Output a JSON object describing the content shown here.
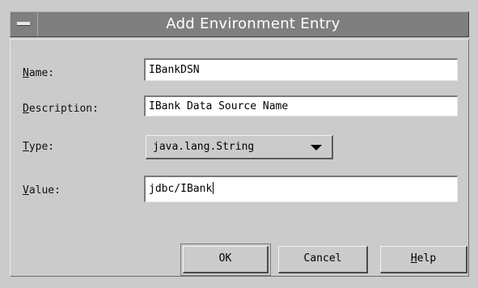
{
  "window": {
    "title": "Add Environment Entry"
  },
  "form": {
    "name_label_accel": "N",
    "name_label_rest": "ame:",
    "name_value": "IBankDSN",
    "description_label_accel": "D",
    "description_label_rest": "escription:",
    "description_value": "IBank Data Source Name",
    "type_label_accel": "T",
    "type_label_rest": "ype:",
    "type_selected": "java.lang.String",
    "value_label_accel": "V",
    "value_label_rest": "alue:",
    "value_value": "jdbc/IBank"
  },
  "buttons": {
    "ok": "OK",
    "cancel": "Cancel",
    "help_accel": "H",
    "help_rest": "elp"
  },
  "icons": {
    "system_menu": "window-menu-icon",
    "dropdown": "triangle-down-icon"
  }
}
